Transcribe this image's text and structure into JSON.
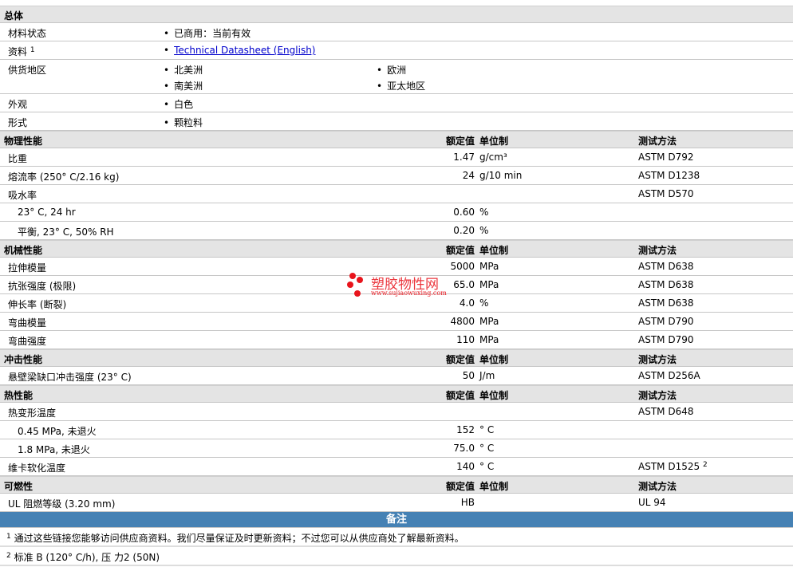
{
  "general": {
    "title": "总体",
    "rows": [
      {
        "label": "材料状态",
        "items": [
          "已商用：当前有效"
        ]
      },
      {
        "label": "资料",
        "sup": "1",
        "link": "Technical Datasheet (English)"
      },
      {
        "label": "供货地区",
        "items": [
          "北美洲",
          "欧洲",
          "南美洲",
          "亚太地区"
        ]
      },
      {
        "label": "外观",
        "items": [
          "白色"
        ]
      },
      {
        "label": "形式",
        "items": [
          "颗粒料"
        ]
      }
    ]
  },
  "columns": {
    "value": "额定值",
    "unit": "单位制",
    "method": "测试方法"
  },
  "sections": [
    {
      "title": "物理性能",
      "rows": [
        {
          "label": "比重",
          "value": "1.47",
          "unit": "g/cm³",
          "method": "ASTM D792"
        },
        {
          "label": "熔流率 (250° C/2.16 kg)",
          "value": "24",
          "unit": "g/10 min",
          "method": "ASTM D1238"
        },
        {
          "label": "吸水率",
          "value": "",
          "unit": "",
          "method": "ASTM D570"
        },
        {
          "label": "23° C, 24 hr",
          "value": "0.60",
          "unit": "%",
          "method": "",
          "indent": true
        },
        {
          "label": "平衡, 23° C, 50% RH",
          "value": "0.20",
          "unit": "%",
          "method": "",
          "indent": true
        }
      ]
    },
    {
      "title": "机械性能",
      "rows": [
        {
          "label": "拉伸模量",
          "value": "5000",
          "unit": "MPa",
          "method": "ASTM D638"
        },
        {
          "label": "抗张强度 (极限)",
          "value": "65.0",
          "unit": "MPa",
          "method": "ASTM D638"
        },
        {
          "label": "伸长率 (断裂)",
          "value": "4.0",
          "unit": "%",
          "method": "ASTM D638"
        },
        {
          "label": "弯曲模量",
          "value": "4800",
          "unit": "MPa",
          "method": "ASTM D790"
        },
        {
          "label": "弯曲强度",
          "value": "110",
          "unit": "MPa",
          "method": "ASTM D790"
        }
      ]
    },
    {
      "title": "冲击性能",
      "rows": [
        {
          "label": "悬壁梁缺口冲击强度 (23° C)",
          "value": "50",
          "unit": "J/m",
          "method": "ASTM D256A"
        }
      ]
    },
    {
      "title": "热性能",
      "rows": [
        {
          "label": "热变形温度",
          "value": "",
          "unit": "",
          "method": "ASTM D648"
        },
        {
          "label": "0.45 MPa, 未退火",
          "value": "152",
          "unit": "° C",
          "method": "",
          "indent": true
        },
        {
          "label": "1.8 MPa, 未退火",
          "value": "75.0",
          "unit": "° C",
          "method": "",
          "indent": true
        },
        {
          "label": "维卡软化温度",
          "value": "140",
          "unit": "° C",
          "method": "ASTM D1525",
          "sup": "2"
        }
      ]
    },
    {
      "title": "可燃性",
      "rows": [
        {
          "label": "UL 阻燃等级 (3.20 mm)",
          "value": "HB",
          "unit": "",
          "method": "UL 94"
        }
      ]
    }
  ],
  "notes": {
    "title": "备注",
    "items": [
      {
        "num": "1",
        "text": "通过这些链接您能够访问供应商资料。我们尽量保证及时更新资料；不过您可以从供应商处了解最新资料。"
      },
      {
        "num": "2",
        "text": "标准 B (120° C/h), 压 力2 (50N)"
      }
    ]
  },
  "watermark": {
    "name": "塑胶物性网",
    "url": "www.sujiaowuxing.com",
    "color": "#e8141c"
  }
}
